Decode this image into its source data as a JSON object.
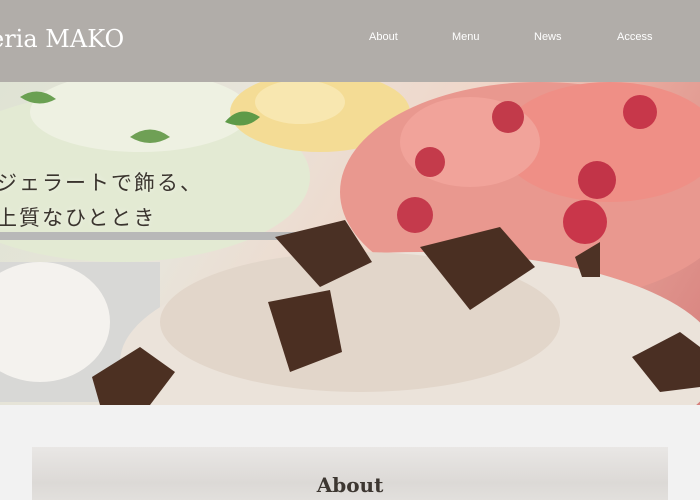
{
  "header": {
    "logo": "eria MAKO",
    "nav": [
      {
        "label": "About"
      },
      {
        "label": "Menu"
      },
      {
        "label": "News"
      },
      {
        "label": "Access"
      }
    ]
  },
  "hero": {
    "tagline_line1": "ジェラートで飾る、",
    "tagline_line2": "上質なひととき"
  },
  "about": {
    "title": "About"
  },
  "colors": {
    "header_bg": "#b1ada9",
    "page_bg": "#f2f2f2",
    "text_dark": "#3d3731"
  }
}
